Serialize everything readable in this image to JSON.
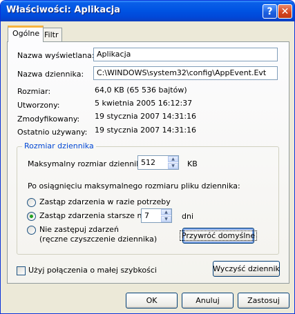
{
  "window": {
    "title": "Właściwości: Aplikacja",
    "help_glyph": "?",
    "close_glyph": "✕"
  },
  "tabs": [
    {
      "label": "Ogólne",
      "active": true
    },
    {
      "label": "Filtr",
      "active": false
    }
  ],
  "fields": {
    "display_name_label": "Nazwa wyświetlana:",
    "display_name_value": "Aplikacja",
    "log_name_label": "Nazwa dziennika:",
    "log_name_value": "C:\\WINDOWS\\system32\\config\\AppEvent.Evt",
    "size_label": "Rozmiar:",
    "size_value": "64,0 KB (65 536 bajtów)",
    "created_label": "Utworzony:",
    "created_value": "5 kwietnia 2005 16:12:37",
    "modified_label": "Zmodyfikowany:",
    "modified_value": "19 stycznia 2007 14:31:16",
    "accessed_label": "Ostatnio używany:",
    "accessed_value": "19 stycznia 2007 14:31:16"
  },
  "log_size": {
    "group_title": "Rozmiar dziennika",
    "max_size_label": "Maksymalny rozmiar dziennika:",
    "max_size_value": "512",
    "max_size_unit": "KB",
    "when_full_label": "Po osiągnięciu maksymalnego rozmiaru pliku dziennika:",
    "option_overwrite_as_needed": "Zastąp zdarzenia w razie potrzeby",
    "option_overwrite_older": "Zastąp zdarzenia starsze niż",
    "days_value": "7",
    "days_unit": "dni",
    "option_do_not_overwrite": "Nie zastępuj zdarzeń",
    "option_do_not_overwrite_note": "(ręczne czyszczenie dziennika)",
    "selected_option": "overwrite_older",
    "restore_defaults_button": "Przywróć domyślne"
  },
  "low_speed": {
    "label": "Użyj połączenia o małej szybkości",
    "checked": false
  },
  "clear_log_button": "Wyczyść dziennik",
  "footer": {
    "ok": "OK",
    "cancel": "Anuluj",
    "apply": "Zastosuj"
  },
  "colors": {
    "title_bar": "#0054e3",
    "dialog_bg": "#ece9d8",
    "group_title": "#0046d5",
    "radio_dot": "#21a121"
  }
}
